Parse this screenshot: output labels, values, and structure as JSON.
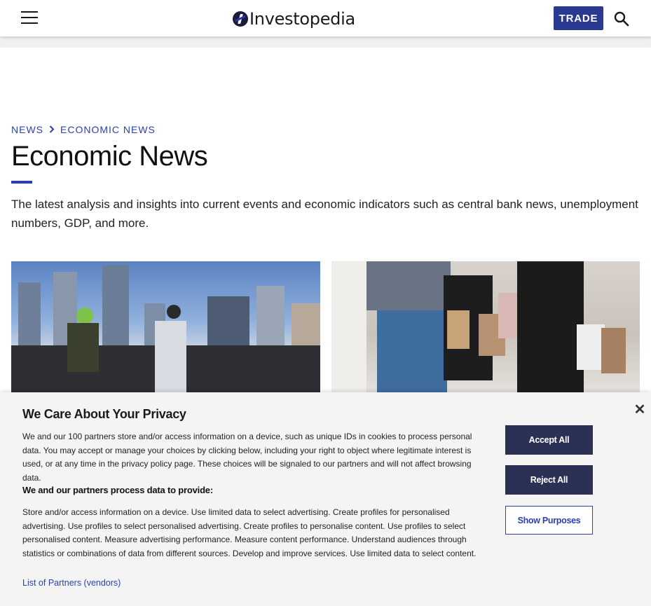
{
  "header": {
    "logo_text": "Investopedia",
    "trade_label": "TRADE"
  },
  "breadcrumb": {
    "items": [
      "NEWS",
      "ECONOMIC NEWS"
    ]
  },
  "page": {
    "title": "Economic News",
    "intro": "The latest analysis and insights into current events and economic indicators such as central bank news, unemployment numbers, GDP, and more."
  },
  "consent": {
    "title": "We Care About Your Privacy",
    "body": "We and our 100 partners store and/or access information on a device, such as unique IDs in cookies to process personal data. You may accept or manage your choices by clicking below, including your right to object where legitimate interest is used, or at any time in the privacy policy page. These choices will be signaled to our partners and will not affect browsing data.",
    "subtitle": "We and our partners process data to provide:",
    "purposes": "Store and/or access information on a device. Use limited data to select advertising. Create profiles for personalised advertising. Use profiles to select personalised advertising. Create profiles to personalise content. Use profiles to select personalised content. Measure advertising performance. Measure content performance. Understand audiences through statistics or combinations of data from different sources. Develop and improve services. Use limited data to select content.",
    "partners_link": "List of Partners (vendors)",
    "accept_label": "Accept All",
    "reject_label": "Reject All",
    "purposes_label": "Show Purposes",
    "close_glyph": "✕"
  },
  "colors": {
    "brand_blue": "#2b3fb0",
    "trade_bg": "#2b3990",
    "button_dark": "#2b3154"
  }
}
